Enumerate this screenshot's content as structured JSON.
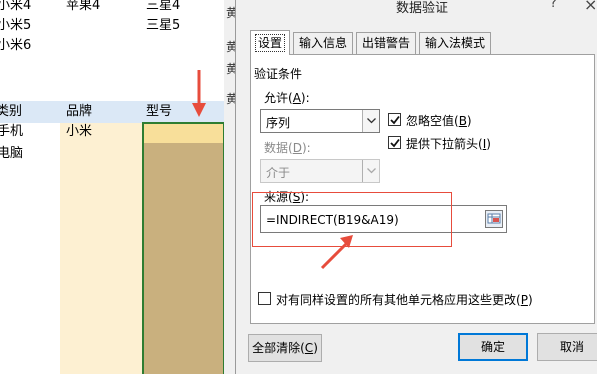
{
  "sheet": {
    "top_rows": [
      {
        "a": "小米4",
        "b": "苹果4",
        "c": "三星4"
      },
      {
        "a": "小米5",
        "b": "",
        "c": "三星5"
      },
      {
        "a": "小米6",
        "b": "",
        "c": ""
      }
    ],
    "header": {
      "a": "类别",
      "b": "品牌",
      "c": "型号"
    },
    "data_rows": [
      {
        "a": "手机",
        "b": "小米"
      },
      {
        "a": "电脑",
        "b": ""
      }
    ],
    "gap_chars": [
      "黄",
      "黄",
      "黄",
      "黄"
    ]
  },
  "dialog": {
    "title": "数据验证",
    "help": "?",
    "tabs": [
      "设置",
      "输入信息",
      "出错警告",
      "输入法模式"
    ],
    "group_title": "验证条件",
    "allow_label": "允许(",
    "allow_key": "A",
    "allow_suffix": "):",
    "allow_value": "序列",
    "data_label": "数据(",
    "data_key": "D",
    "data_suffix": "):",
    "data_value": "介于",
    "ignore_blank": {
      "prefix": "忽略空值(",
      "key": "B",
      "suffix": ")",
      "checked": true
    },
    "dropdown_arrow": {
      "prefix": "提供下拉箭头(",
      "key": "I",
      "suffix": ")",
      "checked": true
    },
    "source_label": {
      "prefix": "来源(",
      "key": "S",
      "suffix": "):"
    },
    "source_value": "=INDIRECT(B19&A19)",
    "apply_all": {
      "prefix": "对有同样设置的所有其他单元格应用这些更改(",
      "key": "P",
      "suffix": ")",
      "checked": false
    },
    "buttons": {
      "clear_all": {
        "prefix": "全部清除(",
        "key": "C",
        "suffix": ")"
      },
      "ok": "确定",
      "cancel": "取消"
    }
  },
  "colors": {
    "annotation": "#e74c3c",
    "selection_border": "#2e7d32",
    "header_fill": "#dbe8f6",
    "brand_fill": "#fdf0d2",
    "model_fill": "#c9b07e"
  }
}
